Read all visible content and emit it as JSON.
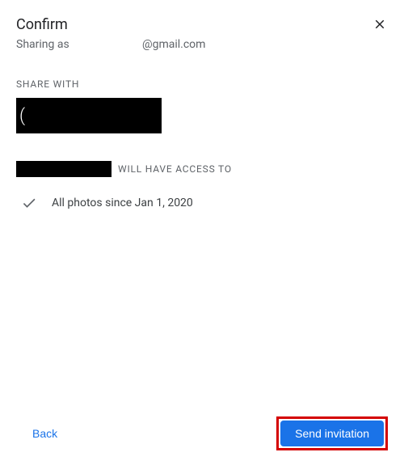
{
  "header": {
    "title": "Confirm",
    "sharing_prefix": "Sharing as",
    "sharing_email_suffix": "@gmail.com"
  },
  "share_with_label": "SHARE WITH",
  "access_label": "WILL HAVE ACCESS TO",
  "access_item": "All photos since Jan 1, 2020",
  "footer": {
    "back_label": "Back",
    "send_label": "Send invitation"
  }
}
